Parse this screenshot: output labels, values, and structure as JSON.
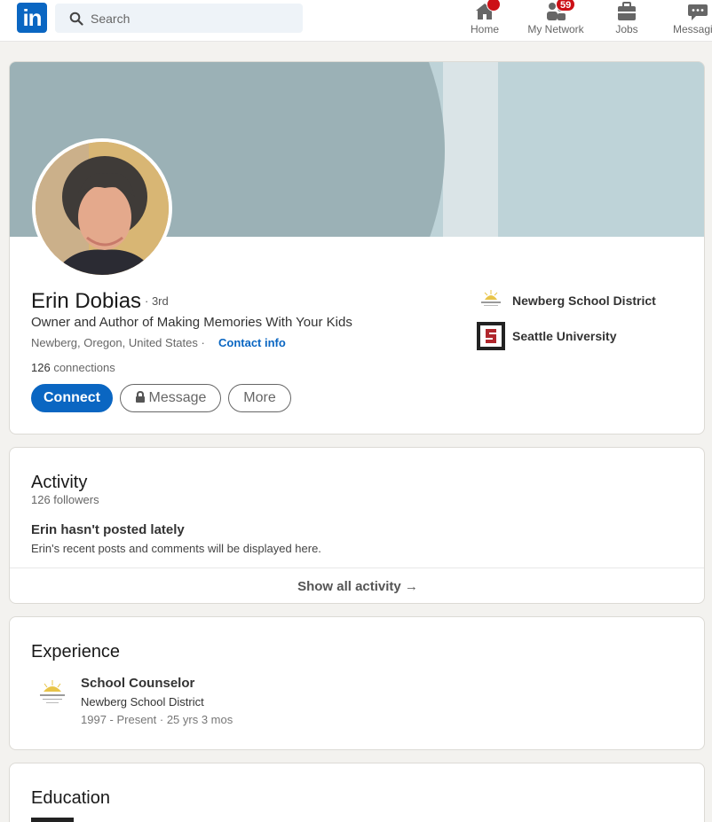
{
  "nav": {
    "search_placeholder": "Search",
    "items": [
      {
        "label": "Home",
        "badge": ""
      },
      {
        "label": "My Network",
        "badge": "59"
      },
      {
        "label": "Jobs",
        "badge": ""
      },
      {
        "label": "Messaging",
        "badge": ""
      }
    ]
  },
  "profile": {
    "name": "Erin Dobias",
    "degree": "· 3rd",
    "headline": "Owner and Author of Making Memories With Your Kids",
    "location": "Newberg, Oregon, United States ·",
    "contact_info": "Contact info",
    "connections_count": "126",
    "connections_label": "connections",
    "buttons": {
      "connect": "Connect",
      "message": "Message",
      "more": "More"
    },
    "orgs": [
      "Newberg School District",
      "Seattle University"
    ]
  },
  "activity": {
    "title": "Activity",
    "followers": "126 followers",
    "empty_title": "Erin hasn't posted lately",
    "empty_desc": "Erin's recent posts and comments will be displayed here.",
    "show_all": "Show all activity →"
  },
  "experience": {
    "title": "Experience",
    "items": [
      {
        "title": "School Counselor",
        "org": "Newberg School District",
        "dates": "1997 - Present · 25 yrs 3 mos"
      }
    ]
  },
  "education": {
    "title": "Education"
  },
  "colors": {
    "brand": "#0a66c2",
    "badge": "#cc1016"
  }
}
